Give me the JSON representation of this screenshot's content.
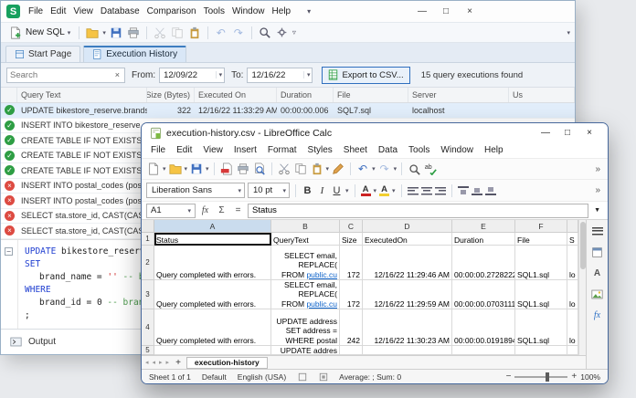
{
  "glyphs": {
    "caret": "▾",
    "chev": "▿",
    "expand": "▼",
    "min": "—",
    "max": "□",
    "close": "×",
    "check": "✓",
    "cross": "×",
    "undo": "↶",
    "redo": "↷",
    "sum": "Σ",
    "fx": "fx",
    "eq": "=",
    "more": "»",
    "plus": "+",
    "navl": "◂",
    "navr": "▸",
    "bold": "B",
    "italic": "I",
    "underline": "U",
    "letterA": "A",
    "minus": "−",
    "clear": "×"
  },
  "dbforge": {
    "logo": "S",
    "menus": [
      "File",
      "Edit",
      "View",
      "Database",
      "Comparison",
      "Tools",
      "Window",
      "Help"
    ],
    "new_sql": "New SQL",
    "tabs": {
      "start": "Start Page",
      "history": "Execution History"
    },
    "filter": {
      "search_placeholder": "Search",
      "from_label": "From:",
      "from_value": "12/09/22",
      "to_label": "To:",
      "to_value": "12/16/22",
      "export_label": "Export to CSV...",
      "results": "15 query executions found"
    },
    "grid": {
      "headers": [
        "Query Text",
        "Size (Bytes)",
        "Executed On",
        "Duration",
        "File",
        "Server",
        "Us"
      ],
      "rows": [
        {
          "query": "UPDATE bikestore_reserve.brands S...",
          "size": "322",
          "executed": "12/16/22 11:33:29 AM",
          "duration": "00:00:00.006",
          "file": "SQL7.sql",
          "server": "localhost"
        },
        {
          "query": "INSERT INTO bikestore_reserve.cust..."
        },
        {
          "query": "CREATE TABLE IF NOT EXISTS bikest..."
        },
        {
          "query": "CREATE TABLE IF NOT EXISTS bikest..."
        },
        {
          "query": "CREATE TABLE IF NOT EXISTS stores ..."
        },
        {
          "query": "INSERT INTO postal_codes (postal_..."
        },
        {
          "query": "INSERT INTO postal_codes (postal_..."
        },
        {
          "query": "SELECT sta.store_id, CAST(CAST(AV..."
        },
        {
          "query": "SELECT sta.store_id, CAST(CAST(AV..."
        }
      ]
    },
    "sql": {
      "l1_kw": "UPDATE",
      "l1_rest": " bikestore_reserve.bra",
      "l2_kw": "SET",
      "l3_id": "brand_name",
      "l3_op": " = ",
      "l3_str": "''",
      "l3_cmt": " -- brand_n",
      "l4_kw": "WHERE",
      "l5_id": "brand_id",
      "l5_op": " = ",
      "l5_num": "0",
      "l5_cmt": " -- brand_id =",
      "l6": ";"
    },
    "output": "Output"
  },
  "calc": {
    "title": "execution-history.csv - LibreOffice Calc",
    "menus": [
      "File",
      "Edit",
      "View",
      "Insert",
      "Format",
      "Styles",
      "Sheet",
      "Data",
      "Tools",
      "Window",
      "Help"
    ],
    "font_name": "Liberation Sans",
    "font_size": "10 pt",
    "name_box": "A1",
    "formula_value": "Status",
    "col_headers": [
      "A",
      "B",
      "C",
      "D",
      "E",
      "F"
    ],
    "rows": {
      "r1": {
        "num": "1",
        "a": "Status",
        "b": "QueryText",
        "c": "Size",
        "d": "ExecutedOn",
        "e": "Duration",
        "f": "File",
        "g": "S"
      },
      "r2": {
        "num": "2",
        "a": "Query completed with errors.",
        "b1": "SELECT email,",
        "b2": "REPLACE(",
        "b3": "FROM ",
        "b3_link": "public.cu",
        "c": "172",
        "d": "12/16/22 11:29:46 AM",
        "e": "00:00:00.2728222",
        "f": "SQL1.sql",
        "g": "lo"
      },
      "r3": {
        "num": "3",
        "a": "Query completed with errors.",
        "b1": "SELECT email,",
        "b2": "REPLACE(",
        "b3": "FROM ",
        "b3_link": "public.cu",
        "c": "172",
        "d": "12/16/22 11:29:59 AM",
        "e": "00:00:00.0703111",
        "f": "SQL1.sql",
        "g": "lo"
      },
      "r4": {
        "num": "4",
        "a": "Query completed with errors.",
        "b1": "UPDATE address",
        "b2": "SET address =",
        "b3": "WHERE postal",
        "c": "242",
        "d": "12/16/22 11:30:23 AM",
        "e": "00:00:00.0191894",
        "f": "SQL1.sql",
        "g": "lo"
      },
      "r5": {
        "num": "5",
        "b1": "UPDATE addres"
      }
    },
    "sheet_tab": "execution-history",
    "status": {
      "sheets": "Sheet 1 of 1",
      "style": "Default",
      "language": "English (USA)",
      "stats": "Average: ; Sum: 0",
      "zoom": "100%"
    }
  }
}
